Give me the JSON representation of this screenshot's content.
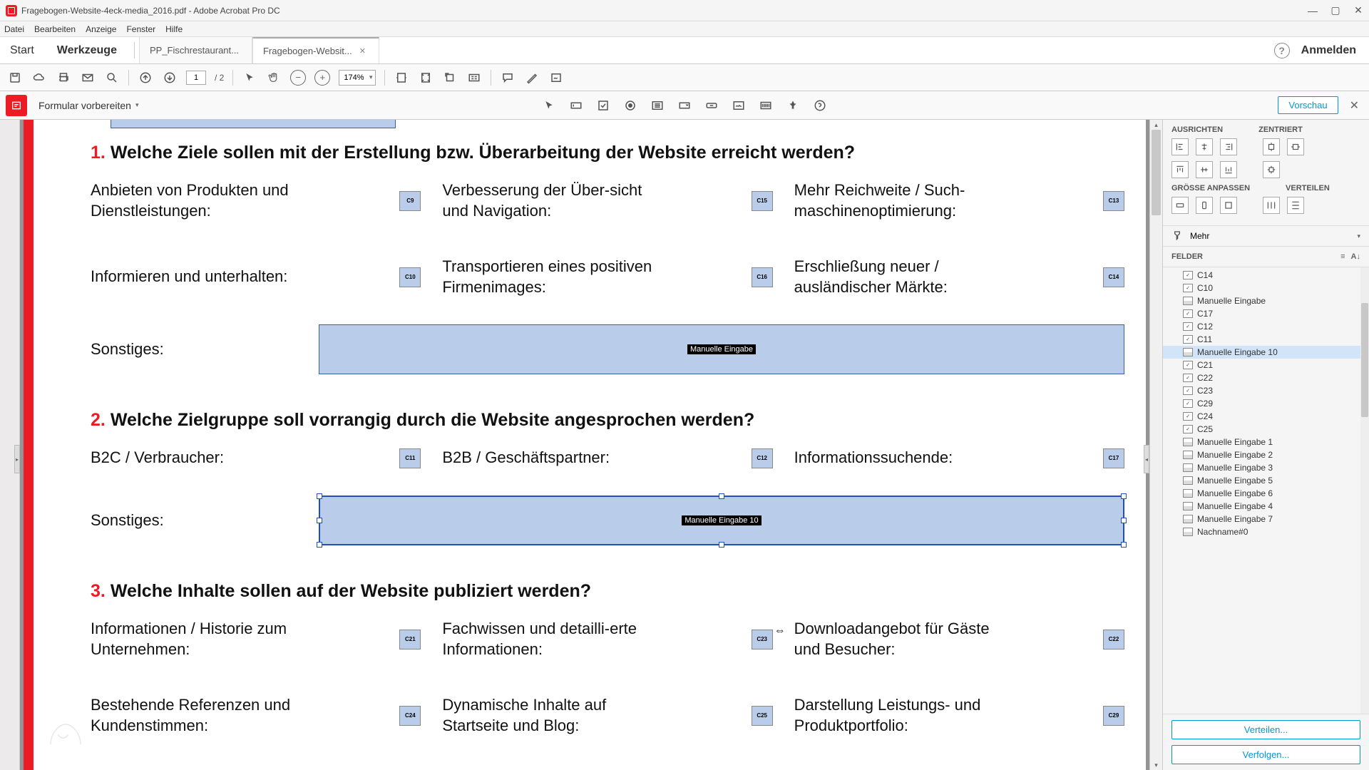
{
  "titlebar": {
    "title": "Fragebogen-Website-4eck-media_2016.pdf - Adobe Acrobat Pro DC"
  },
  "menubar": [
    "Datei",
    "Bearbeiten",
    "Anzeige",
    "Fenster",
    "Hilfe"
  ],
  "tabsRow": {
    "start": "Start",
    "tools": "Werkzeuge",
    "tabs": [
      {
        "label": "PP_Fischrestaurant...",
        "active": false
      },
      {
        "label": "Fragebogen-Websit...",
        "active": true
      }
    ],
    "signin": "Anmelden"
  },
  "mainToolbar": {
    "page_current": "1",
    "page_total": "/ 2",
    "zoom": "174%"
  },
  "secToolbar": {
    "dropdown": "Formular vorbereiten",
    "preview": "Vorschau"
  },
  "doc": {
    "q1": {
      "num": "1.",
      "text": "Welche Ziele sollen mit der Erstellung bzw. Überarbeitung der Website erreicht werden?",
      "items": [
        {
          "label": "Anbieten von Produkten und Dienstleistungen:",
          "tag": "C9"
        },
        {
          "label": "Verbesserung der Über-sicht und Navigation:",
          "tag": "C15"
        },
        {
          "label": "Mehr Reichweite / Such-maschinenoptimierung:",
          "tag": "C13"
        },
        {
          "label": "Informieren und unterhalten:",
          "tag": "C10"
        },
        {
          "label": "Transportieren eines positiven Firmenimages:",
          "tag": "C16"
        },
        {
          "label": "Erschließung neuer / ausländischer Märkte:",
          "tag": "C14"
        }
      ],
      "sonstiges": "Sonstiges:",
      "field_tag": "Manuelle Eingabe"
    },
    "q2": {
      "num": "2.",
      "text": "Welche Zielgruppe soll vorrangig durch die Website angesprochen werden?",
      "items": [
        {
          "label": "B2C / Verbraucher:",
          "tag": "C11"
        },
        {
          "label": "B2B / Geschäftspartner:",
          "tag": "C12"
        },
        {
          "label": "Informationssuchende:",
          "tag": "C17"
        }
      ],
      "sonstiges": "Sonstiges:",
      "field_tag": "Manuelle Eingabe 10"
    },
    "q3": {
      "num": "3.",
      "text": "Welche Inhalte sollen auf der Website publiziert werden?",
      "items": [
        {
          "label": "Informationen / Historie zum Unternehmen:",
          "tag": "C21"
        },
        {
          "label": "Fachwissen und detailli-erte Informationen:",
          "tag": "C23"
        },
        {
          "label": "Downloadangebot für Gäste und Besucher:",
          "tag": "C22"
        },
        {
          "label": "Bestehende Referenzen und Kundenstimmen:",
          "tag": "C24"
        },
        {
          "label": "Dynamische Inhalte auf Startseite und Blog:",
          "tag": "C25"
        },
        {
          "label": "Darstellung Leistungs- und Produktportfolio:",
          "tag": "C29"
        }
      ]
    }
  },
  "rightPanel": {
    "ausrichten": "AUSRICHTEN",
    "zentriert": "ZENTRIERT",
    "groesse": "GRÖSSE ANPASSEN",
    "verteilen": "VERTEILEN",
    "mehr": "Mehr",
    "felder": "FELDER",
    "fields": [
      {
        "name": "C14",
        "type": "cb"
      },
      {
        "name": "C10",
        "type": "cb"
      },
      {
        "name": "Manuelle Eingabe",
        "type": "tx"
      },
      {
        "name": "C17",
        "type": "cb"
      },
      {
        "name": "C12",
        "type": "cb"
      },
      {
        "name": "C11",
        "type": "cb"
      },
      {
        "name": "Manuelle Eingabe 10",
        "type": "tx",
        "selected": true
      },
      {
        "name": "C21",
        "type": "cb"
      },
      {
        "name": "C22",
        "type": "cb"
      },
      {
        "name": "C23",
        "type": "cb"
      },
      {
        "name": "C29",
        "type": "cb"
      },
      {
        "name": "C24",
        "type": "cb"
      },
      {
        "name": "C25",
        "type": "cb"
      },
      {
        "name": "Manuelle Eingabe 1",
        "type": "tx"
      },
      {
        "name": "Manuelle Eingabe 2",
        "type": "tx"
      },
      {
        "name": "Manuelle Eingabe 3",
        "type": "tx"
      },
      {
        "name": "Manuelle Eingabe 5",
        "type": "tx"
      },
      {
        "name": "Manuelle Eingabe 6",
        "type": "tx"
      },
      {
        "name": "Manuelle Eingabe 4",
        "type": "tx"
      },
      {
        "name": "Manuelle Eingabe 7",
        "type": "tx"
      },
      {
        "name": "Nachname#0",
        "type": "tx"
      }
    ],
    "verteilen_btn": "Verteilen...",
    "verfolgen_btn": "Verfolgen..."
  }
}
